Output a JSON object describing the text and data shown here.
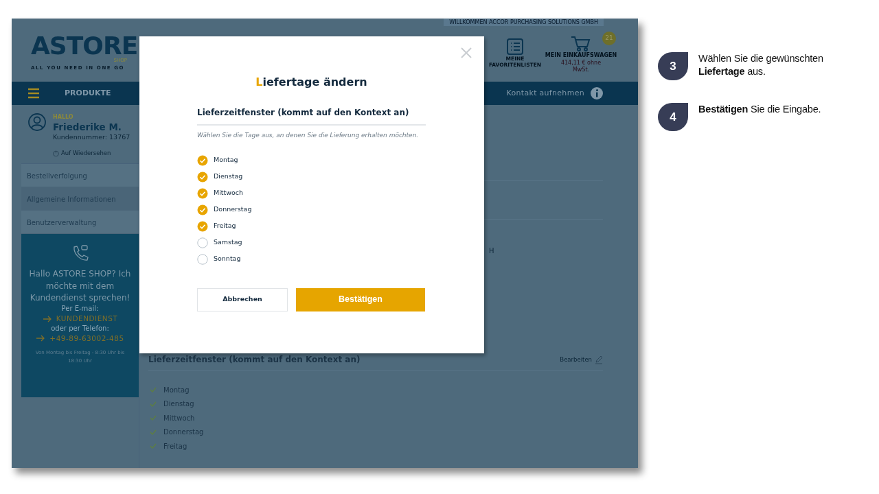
{
  "page": {
    "welcome_banner": "WILLKOMMEN ACCOR PURCHASING SOLUTIONS GMBH",
    "logo": {
      "name": "ASTORE",
      "sub": "SHOP",
      "tagline": "ALL YOU NEED IN ONE GO"
    },
    "favorites": {
      "label": "MEINE FAVORITENLISTEN"
    },
    "cart": {
      "label": "MEIN EINKAUFSWAGEN",
      "count": "21",
      "total": "414,11 € ohne MwSt."
    },
    "nav": {
      "menu_label": "PRODUKTE",
      "contact": "Kontakt aufnehmen"
    },
    "user": {
      "greeting": "HALLO",
      "name": "Friederike M.",
      "customer_number": "Kundennummer: 13767",
      "logout": "Auf Wiedersehen"
    },
    "sidebar": {
      "items": [
        {
          "label": "Bestellverfolgung",
          "selected": false
        },
        {
          "label": "Allgemeine Informationen",
          "selected": true
        },
        {
          "label": "Benutzerverwaltung",
          "selected": false
        }
      ]
    },
    "contact_box": {
      "question": "Hallo ASTORE SHOP? Ich möchte mit dem Kundendienst sprechen!",
      "email_label": "Per E-mail:",
      "email_link": "KUNDENDIENST",
      "phone_label": "oder per Telefon:",
      "phone_link": "+49-89-63002-485",
      "hours": "Von Montag bis Freitag - 8:30 Uhr bis 18:30 Uhr"
    },
    "main": {
      "partial_text": "H",
      "section": {
        "title": "Lieferzeitfenster (kommt auf den Kontext an)",
        "edit": "Bearbeiten",
        "days": [
          "Montag",
          "Dienstag",
          "Mittwoch",
          "Donnerstag",
          "Freitag"
        ]
      }
    }
  },
  "modal": {
    "title": "Liefertage ändern",
    "section_title": "Lieferzeitfenster (kommt auf den Kontext an)",
    "hint": "Wählen Sie die Tage aus, an denen Sie die Lieferung erhalten möchten.",
    "days": [
      {
        "label": "Montag",
        "checked": true
      },
      {
        "label": "Dienstag",
        "checked": true
      },
      {
        "label": "Mittwoch",
        "checked": true
      },
      {
        "label": "Donnerstag",
        "checked": true
      },
      {
        "label": "Freitag",
        "checked": true
      },
      {
        "label": "Samstag",
        "checked": false
      },
      {
        "label": "Sonntag",
        "checked": false
      }
    ],
    "buttons": {
      "cancel": "Abbrechen",
      "confirm": "Bestätigen"
    }
  },
  "slide": {
    "steps": [
      {
        "number": "3",
        "text": "Wählen Sie die gewünschten **Liefertage** aus."
      },
      {
        "number": "4",
        "text": "**Bestätigen** Sie die Eingabe."
      }
    ]
  }
}
